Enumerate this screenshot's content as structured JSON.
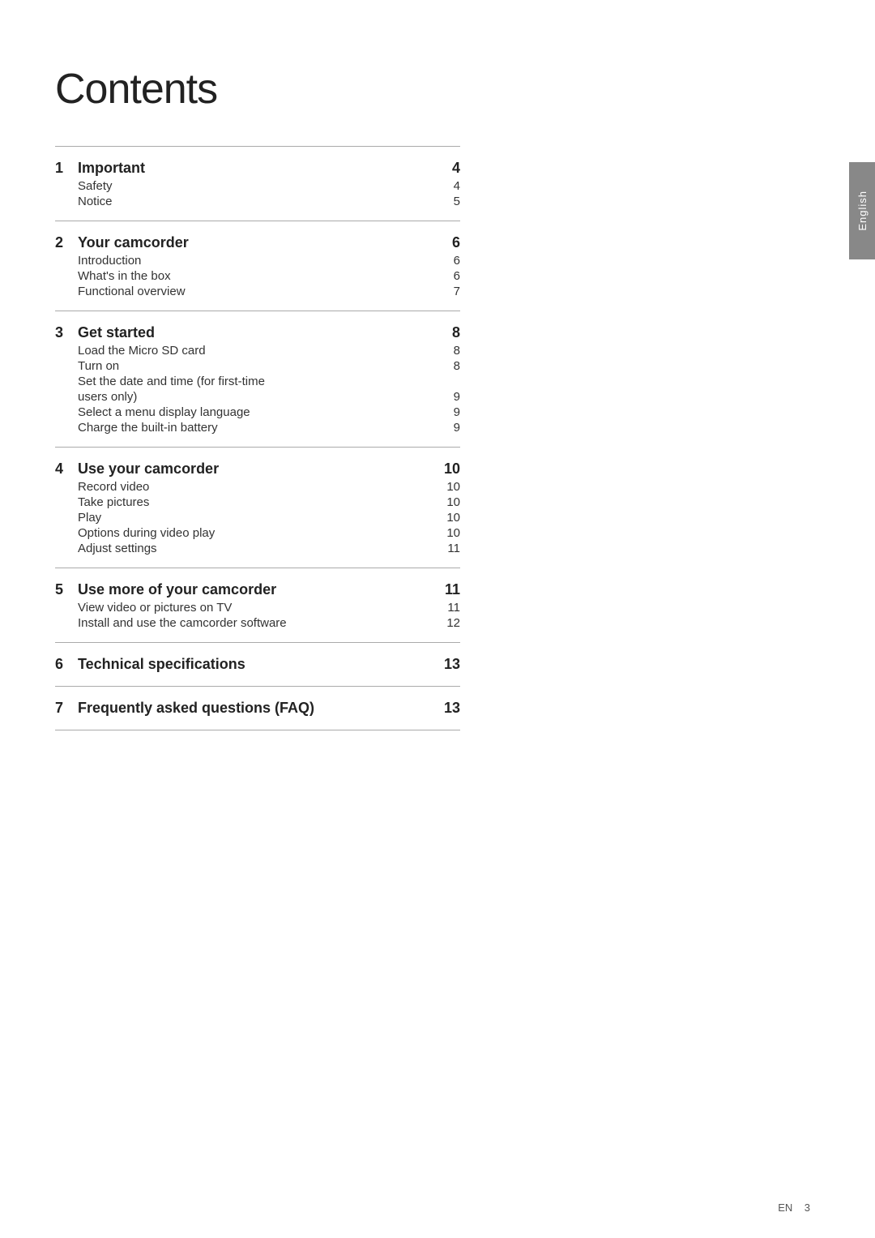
{
  "page": {
    "title": "Contents",
    "side_tab": "English",
    "footer": {
      "lang": "EN",
      "page_num": "3"
    }
  },
  "sections": [
    {
      "number": "1",
      "label": "Important",
      "page": "4",
      "sub_items": [
        {
          "label": "Safety",
          "page": "4"
        },
        {
          "label": "Notice",
          "page": "5"
        }
      ]
    },
    {
      "number": "2",
      "label": "Your camcorder",
      "page": "6",
      "sub_items": [
        {
          "label": "Introduction",
          "page": "6"
        },
        {
          "label": "What's in the box",
          "page": "6"
        },
        {
          "label": "Functional overview",
          "page": "7"
        }
      ]
    },
    {
      "number": "3",
      "label": "Get started",
      "page": "8",
      "sub_items": [
        {
          "label": "Load the Micro SD card",
          "page": "8"
        },
        {
          "label": "Turn on",
          "page": "8"
        },
        {
          "label": "Set the date and time (for first-time",
          "page": ""
        },
        {
          "label": "   users only)",
          "page": "9"
        },
        {
          "label": "Select a menu display language",
          "page": "9"
        },
        {
          "label": "Charge the built-in battery",
          "page": "9"
        }
      ]
    },
    {
      "number": "4",
      "label": "Use your camcorder",
      "page": "10",
      "sub_items": [
        {
          "label": "Record video",
          "page": "10"
        },
        {
          "label": "Take pictures",
          "page": "10"
        },
        {
          "label": "Play",
          "page": "10"
        },
        {
          "label": "Options during video play",
          "page": "10"
        },
        {
          "label": "Adjust settings",
          "page": "11"
        }
      ]
    },
    {
      "number": "5",
      "label": "Use more of your camcorder",
      "page": "11",
      "sub_items": [
        {
          "label": "View video or pictures on TV",
          "page": "11"
        },
        {
          "label": "Install and use the camcorder software",
          "page": "12"
        }
      ]
    },
    {
      "number": "6",
      "label": "Technical specifications",
      "page": "13",
      "sub_items": []
    },
    {
      "number": "7",
      "label": "Frequently asked questions (FAQ)",
      "page": "13",
      "sub_items": []
    }
  ]
}
